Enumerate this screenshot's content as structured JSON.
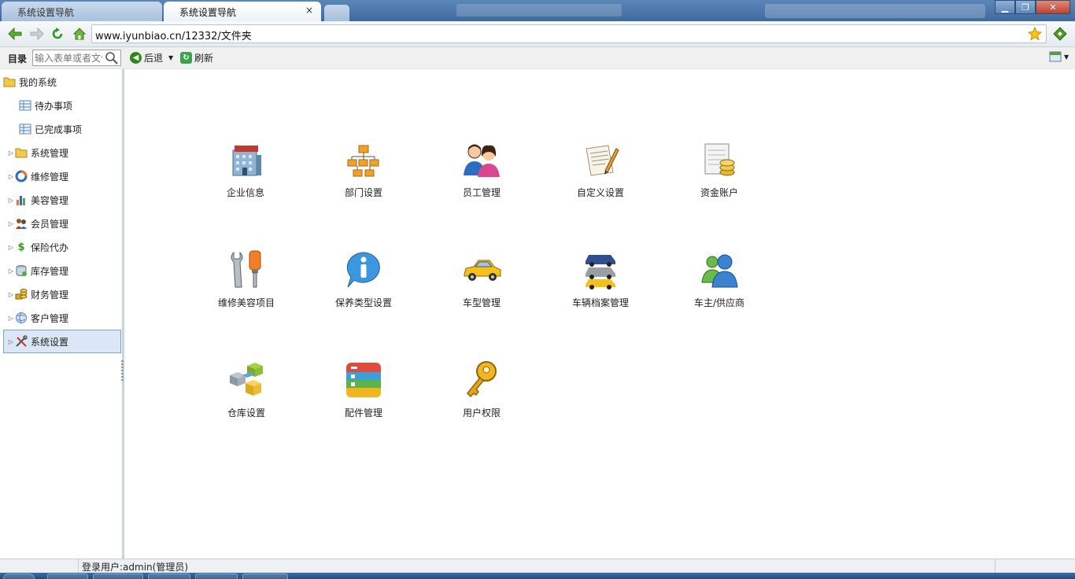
{
  "browser": {
    "tabs": [
      {
        "label": "系统设置导航",
        "active": false
      },
      {
        "label": "系统设置导航",
        "active": true,
        "close": "×"
      }
    ],
    "address": "www.iyunbiao.cn/12332/文件夹",
    "window_controls": {
      "minimize": "▁",
      "maximize": "❐",
      "close": "✕"
    }
  },
  "toolbar": {
    "dir_label": "目录",
    "search_placeholder": "输入表单或者文件",
    "back_label": "后退",
    "refresh_label": "刷新"
  },
  "sidebar": {
    "items": [
      {
        "label": "我的系统",
        "icon": "folder-icon",
        "level": 0
      },
      {
        "label": "待办事项",
        "icon": "table-icon",
        "level": 1
      },
      {
        "label": "已完成事项",
        "icon": "table-icon",
        "level": 1
      },
      {
        "label": "系统管理",
        "icon": "folder-icon",
        "level": 1,
        "expandable": true
      },
      {
        "label": "维修管理",
        "icon": "chart-ring-icon",
        "level": 1,
        "expandable": true
      },
      {
        "label": "美容管理",
        "icon": "bar-chart-icon",
        "level": 1,
        "expandable": true
      },
      {
        "label": "会员管理",
        "icon": "members-icon",
        "level": 1,
        "expandable": true
      },
      {
        "label": "保险代办",
        "icon": "dollar-icon",
        "level": 1,
        "expandable": true
      },
      {
        "label": "库存管理",
        "icon": "database-icon",
        "level": 1,
        "expandable": true
      },
      {
        "label": "财务管理",
        "icon": "coins-icon",
        "level": 1,
        "expandable": true
      },
      {
        "label": "客户管理",
        "icon": "globe-icon",
        "level": 1,
        "expandable": true
      },
      {
        "label": "系统设置",
        "icon": "tools-icon",
        "level": 1,
        "expandable": true,
        "selected": true
      }
    ]
  },
  "grid": {
    "tiles": [
      {
        "label": "企业信息",
        "icon": "company-building-icon"
      },
      {
        "label": "部门设置",
        "icon": "org-chart-icon"
      },
      {
        "label": "员工管理",
        "icon": "people-icon"
      },
      {
        "label": "自定义设置",
        "icon": "document-pen-icon"
      },
      {
        "label": "资金账户",
        "icon": "ledger-coins-icon"
      },
      {
        "label": "维修美容项目",
        "icon": "wrench-screwdriver-icon"
      },
      {
        "label": "保养类型设置",
        "icon": "info-bubble-icon"
      },
      {
        "label": "车型管理",
        "icon": "car-icon"
      },
      {
        "label": "车辆档案管理",
        "icon": "cars-stack-icon"
      },
      {
        "label": "车主/供应商",
        "icon": "users-icon"
      },
      {
        "label": "仓库设置",
        "icon": "blocks-icon"
      },
      {
        "label": "配件管理",
        "icon": "color-menu-icon"
      },
      {
        "label": "用户权限",
        "icon": "key-icon"
      }
    ]
  },
  "status": {
    "user": "登录用户:admin(管理员)"
  },
  "colors": {
    "accent": "#3e6a9f",
    "selected_bg": "#dbe7f6",
    "selected_border": "#7da2ce"
  }
}
